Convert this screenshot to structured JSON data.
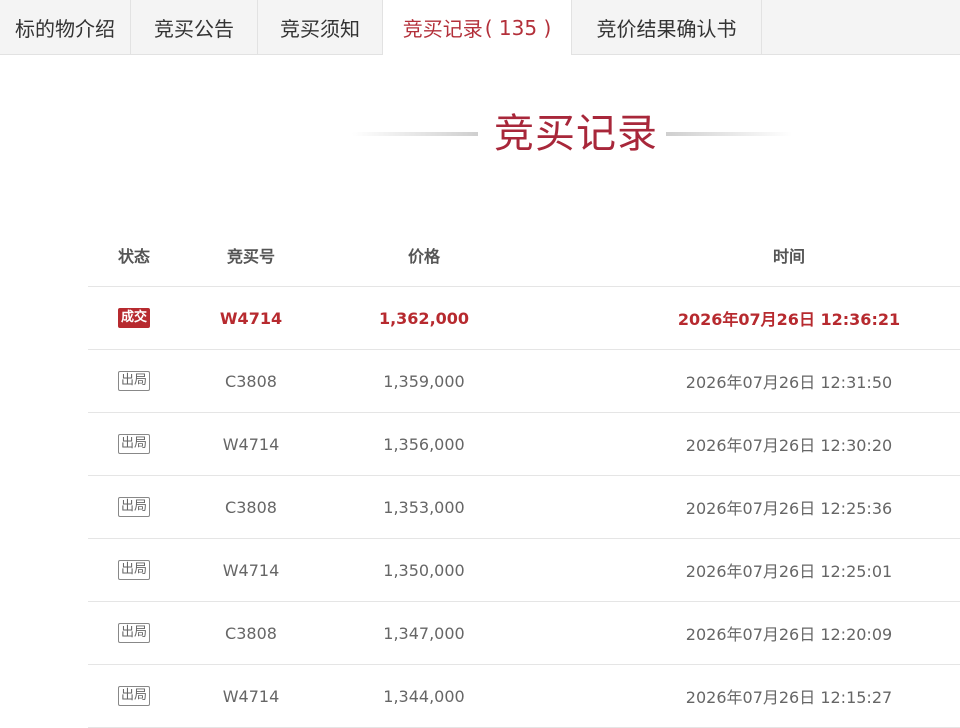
{
  "tabs": [
    {
      "label": "标的物介绍"
    },
    {
      "label": "竞买公告"
    },
    {
      "label": "竞买须知"
    },
    {
      "label": "竞买记录",
      "count": "( 135 )",
      "active": true
    },
    {
      "label": "竞价结果确认书"
    }
  ],
  "section_title": "竞买记录",
  "table": {
    "headers": {
      "status": "状态",
      "bid_no": "竞买号",
      "price": "价格",
      "time": "时间"
    },
    "rows": [
      {
        "status": "成交",
        "bid_no": "W4714",
        "price": "1,362,000",
        "time": "2026年07月26日 12:36:21"
      },
      {
        "status": "出局",
        "bid_no": "C3808",
        "price": "1,359,000",
        "time": "2026年07月26日 12:31:50"
      },
      {
        "status": "出局",
        "bid_no": "W4714",
        "price": "1,356,000",
        "time": "2026年07月26日 12:30:20"
      },
      {
        "status": "出局",
        "bid_no": "C3808",
        "price": "1,353,000",
        "time": "2026年07月26日 12:25:36"
      },
      {
        "status": "出局",
        "bid_no": "W4714",
        "price": "1,350,000",
        "time": "2026年07月26日 12:25:01"
      },
      {
        "status": "出局",
        "bid_no": "C3808",
        "price": "1,347,000",
        "time": "2026年07月26日 12:20:09"
      },
      {
        "status": "出局",
        "bid_no": "W4714",
        "price": "1,344,000",
        "time": "2026年07月26日 12:15:27"
      }
    ]
  },
  "colors": {
    "accent": "#b72a2f",
    "title": "#a8273a"
  }
}
